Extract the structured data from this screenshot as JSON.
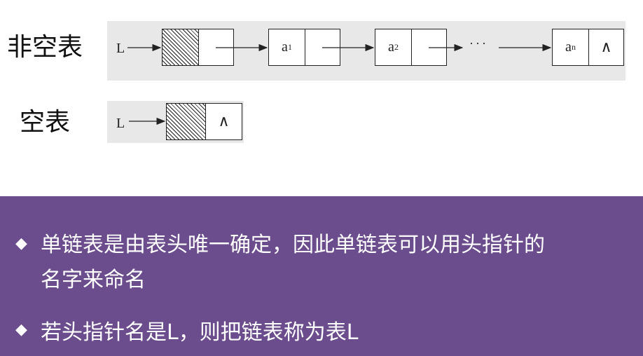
{
  "diagram": {
    "nonempty_label": "非空表",
    "empty_label": "空表",
    "head_pointer": "L",
    "nodes": [
      {
        "base": "a",
        "sub": "1"
      },
      {
        "base": "a",
        "sub": "2"
      },
      {
        "base": "a",
        "sub": "n"
      }
    ],
    "ellipsis": "···",
    "null_symbol": "∧"
  },
  "notes": {
    "bullet_icon": "diamond-bullet-icon",
    "line1a": "单链表是由表头唯一确定，因此单链表可以用头指针的",
    "line1b": "名字来命名",
    "line2": "若头指针名是L，则把链表称为表L"
  },
  "colors": {
    "panel_bg": "#e8e8e8",
    "bottom_bg": "#6b4c8c",
    "text_on_bottom": "#ffffff"
  }
}
